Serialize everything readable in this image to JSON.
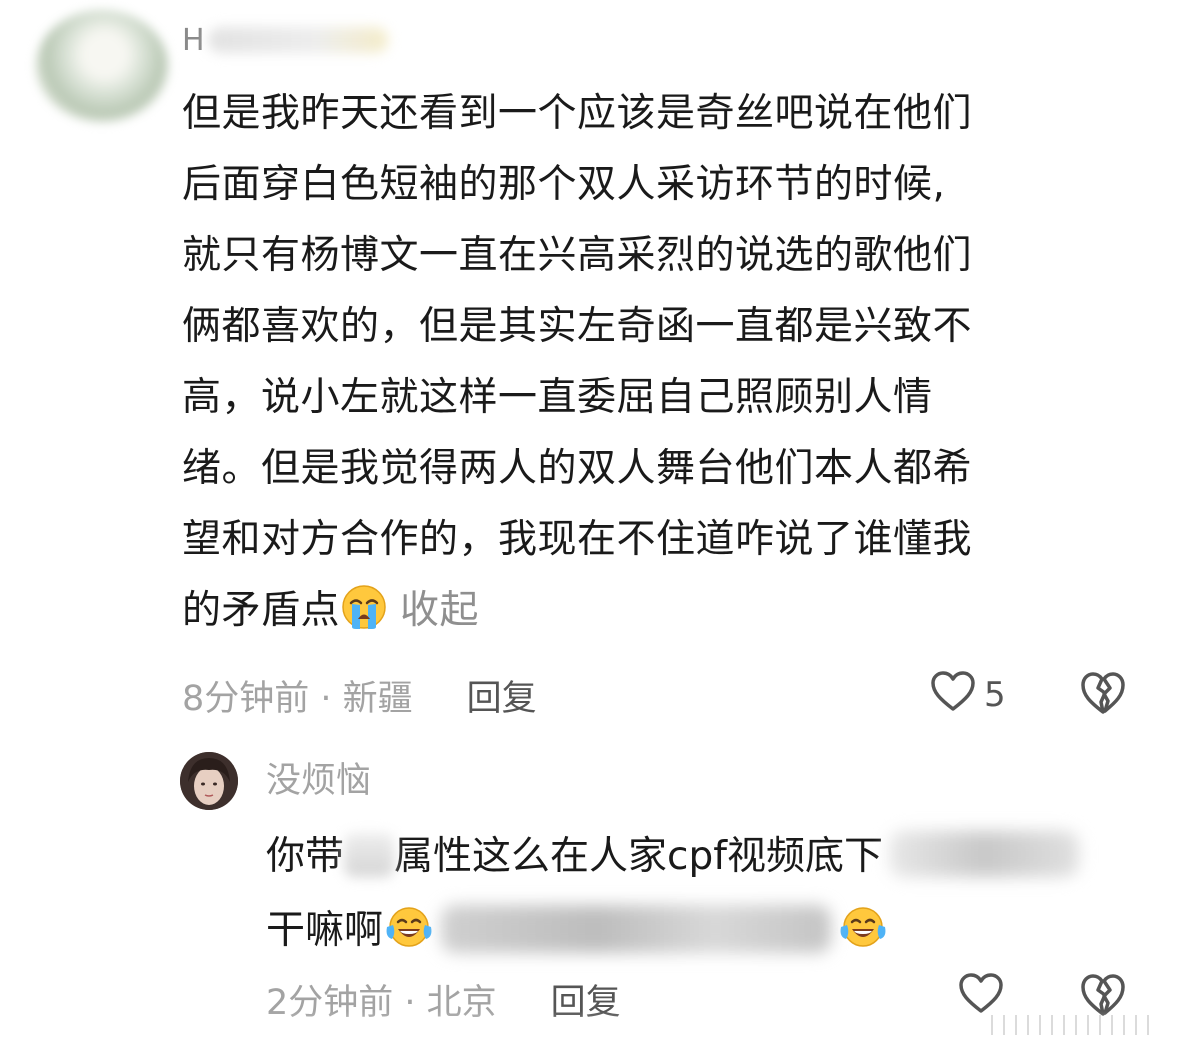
{
  "comment1": {
    "username_visible": "H",
    "lines": [
      "但是我昨天还看到一个应该是奇丝吧说在他们",
      "后面穿白色短袖的那个双人采访环节的时候,",
      "就只有杨博文一直在兴高采烈的说选的歌他们",
      "俩都喜欢的，但是其实左奇函一直都是兴致不",
      "高，说小左就这样一直委屈自己照顾别人情",
      "绪。但是我觉得两人的双人舞台他们本人都希",
      "望和对方合作的，我现在不住道咋说了谁懂我",
      "的矛盾点"
    ],
    "emoji_end": "loudly-crying-face",
    "collapse_label": "收起",
    "meta": "8分钟前 · 新疆",
    "reply_label": "回复",
    "like_count": "5",
    "like_icon": "heart-outline-icon",
    "dislike_icon": "broken-heart-icon"
  },
  "comment2": {
    "username": "没烦恼",
    "line1_a": "你带",
    "line1_b": "属性这么在人家cpf视频底下",
    "line2_a": "干嘛啊",
    "emoji": "face-with-tears-of-joy",
    "meta": "2分钟前 · 北京",
    "reply_label": "回复",
    "like_icon": "heart-outline-icon",
    "dislike_icon": "broken-heart-icon"
  },
  "colors": {
    "text": "#1a1a1a",
    "meta": "#a3a3a3",
    "reply": "#555555",
    "collapse": "#8f8f8f"
  }
}
